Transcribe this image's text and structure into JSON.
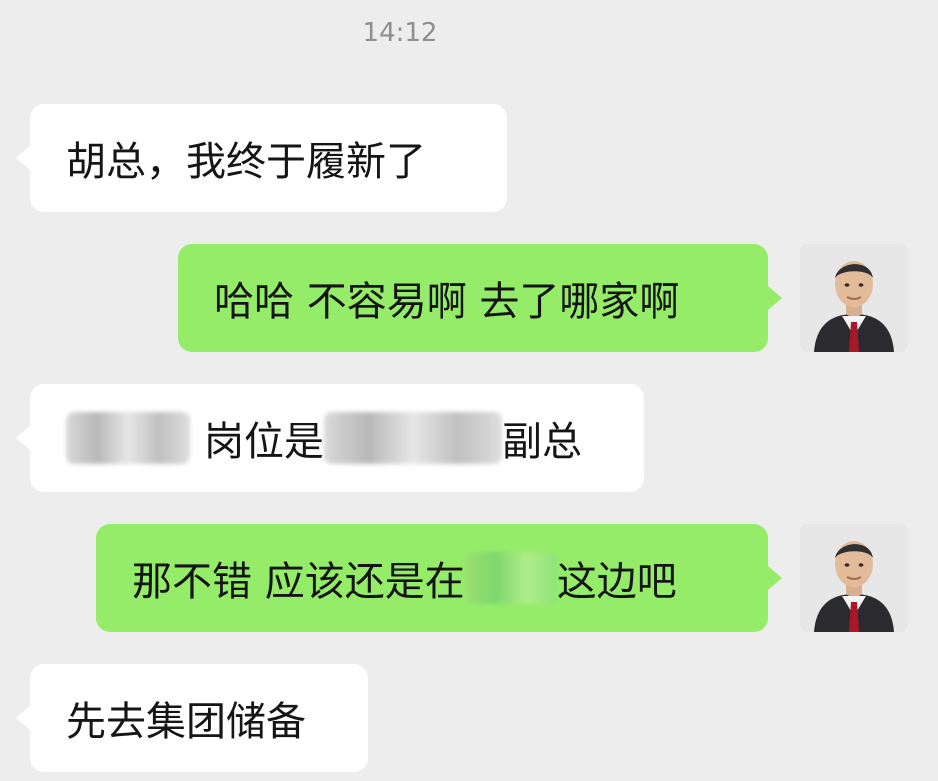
{
  "time": "14:12",
  "messages": [
    {
      "side": "in",
      "text": "胡总，我终于履新了"
    },
    {
      "side": "out",
      "text": "哈哈 不容易啊 去了哪家啊"
    },
    {
      "side": "in",
      "parts": [
        "",
        "岗位是",
        "",
        "副总"
      ]
    },
    {
      "side": "out",
      "parts": [
        "那不错 应该还是在",
        "",
        "这边吧"
      ]
    },
    {
      "side": "in",
      "text": "先去集团储备"
    }
  ],
  "icons": {
    "avatar": "person-in-suit-icon"
  }
}
